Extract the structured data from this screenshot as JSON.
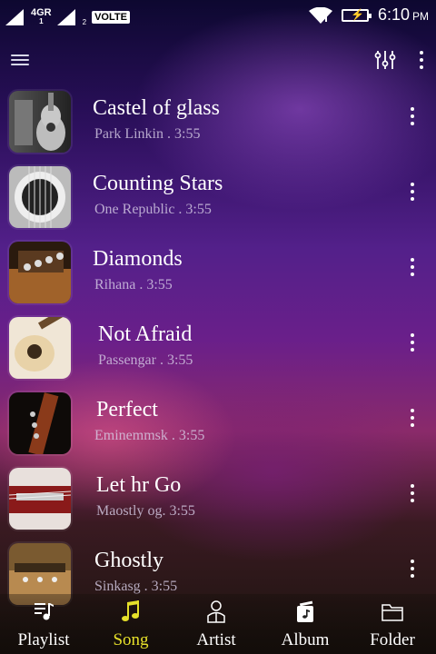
{
  "status_bar": {
    "network": "4GR",
    "sim1": "1",
    "sim2": "2",
    "volte": "VOLTE",
    "time": "6:10",
    "ampm": "PM"
  },
  "songs": [
    {
      "title": "Castel  of  glass",
      "subtitle": "Park Linkin . 3:55"
    },
    {
      "title": "Counting Stars",
      "subtitle": "One Republic . 3:55"
    },
    {
      "title": "Diamonds",
      "subtitle": "Rihana . 3:55"
    },
    {
      "title": "Not Afraid",
      "subtitle": "Passengar . 3:55"
    },
    {
      "title": "Perfect",
      "subtitle": "Eminemmsk . 3:55"
    },
    {
      "title": "Let hr Go",
      "subtitle": "Maostly og. 3:55"
    },
    {
      "title": "Ghostly",
      "subtitle": "Sinkasg . 3:55"
    }
  ],
  "nav": [
    {
      "label": "Playlist",
      "icon": "playlist-icon"
    },
    {
      "label": "Song",
      "icon": "music-note-icon"
    },
    {
      "label": "Artist",
      "icon": "artist-icon"
    },
    {
      "label": "Album",
      "icon": "album-icon"
    },
    {
      "label": "Folder",
      "icon": "folder-icon"
    }
  ],
  "colors": {
    "active_tab": "#e6e02a"
  }
}
